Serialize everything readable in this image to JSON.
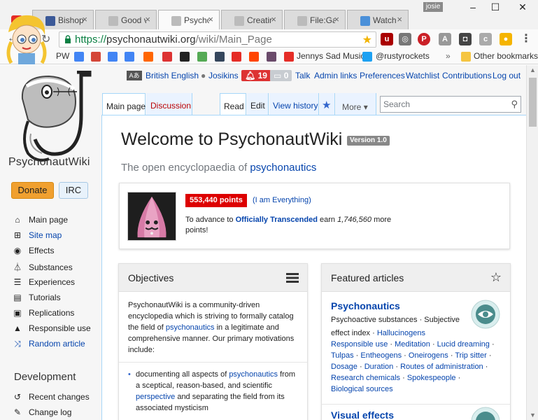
{
  "browser": {
    "tabs": [
      {
        "label": "Bishop N",
        "favicon_color": "#3b5998"
      },
      {
        "label": "Good vib",
        "favicon_color": "#888888"
      },
      {
        "label": "Psychona",
        "favicon_color": "#888888"
      },
      {
        "label": "Creating",
        "favicon_color": "#888888"
      },
      {
        "label": "File:Galle",
        "favicon_color": "#888888"
      },
      {
        "label": "Watch O",
        "favicon_color": "#4a90d9"
      }
    ],
    "profile_name": "josie",
    "url_scheme": "https://",
    "url_host": "psychonautwiki.org",
    "url_path": "/wiki/Main_Page",
    "bookmarks": [
      "PW",
      "Jennys Sad Music",
      "@rustyrockets",
      "Other bookmarks"
    ],
    "bookmark_more": "»",
    "colors": {
      "tab_bar": "#f2f2f2",
      "youtube": "#e52d27",
      "secure": "#0b8043"
    }
  },
  "header": {
    "language": "British English",
    "username": "Josikins",
    "notifications": "19",
    "messages": "0",
    "links": [
      "Talk",
      "Admin links",
      "Preferences",
      "Watchlist",
      "Contributions",
      "Log out"
    ]
  },
  "sidebar": {
    "logo_text": "PsychonautWiki",
    "donate": "Donate",
    "irc": "IRC",
    "items": [
      {
        "label": "Main page",
        "icon": "home-icon"
      },
      {
        "label": "Site map",
        "icon": "sitemap-icon"
      },
      {
        "label": "Effects",
        "icon": "eye-icon"
      },
      {
        "label": "Substances",
        "icon": "flask-icon"
      },
      {
        "label": "Experiences",
        "icon": "list-icon"
      },
      {
        "label": "Tutorials",
        "icon": "book-icon"
      },
      {
        "label": "Replications",
        "icon": "image-icon"
      },
      {
        "label": "Responsible use",
        "icon": "warning-icon"
      },
      {
        "label": "Random article",
        "icon": "random-icon"
      }
    ],
    "dev_heading": "Development",
    "dev_items": [
      {
        "label": "Recent changes",
        "icon": "history-icon"
      },
      {
        "label": "Change log",
        "icon": "changelog-icon"
      }
    ]
  },
  "content_tabs": {
    "left": [
      "Main page",
      "Discussion"
    ],
    "right": [
      "Read",
      "Edit",
      "View history"
    ],
    "more": "More",
    "search_placeholder": "Search"
  },
  "main": {
    "title": "Welcome to PsychonautWiki",
    "version": "Version 1.0",
    "subtitle_prefix": "The open encyclopaedia of ",
    "subtitle_link": "psychonautics",
    "user_points": "553,440 points",
    "user_rank": "(I am Everything)",
    "advance_prefix": "To advance to ",
    "advance_level": "Officially Transcended",
    "advance_mid": " earn ",
    "advance_points": "1,746,560",
    "advance_suffix": " more points!"
  },
  "objectives": {
    "title": "Objectives",
    "intro_1": "PsychonautWiki is a community-driven encyclopedia which is striving to formally catalog the field of ",
    "intro_link": "psychonautics",
    "intro_2": " in a legitimate and comprehensive manner. Our primary motivations include:",
    "bullet_1": "documenting all aspects of ",
    "bullet_link": "psychonautics",
    "bullet_2": " from a sceptical, reason-based, and scientific ",
    "bullet_link_2": "perspective",
    "bullet_3": " and separating the field from its associated mysticism"
  },
  "featured": {
    "title": "Featured articles",
    "article_title": "Psychonautics",
    "article_line1": "Psychoactive substances · Subjective",
    "article_line2": "effect index · ",
    "links": [
      "Hallucinogens",
      "Responsible use",
      "Meditation",
      "Lucid dreaming",
      "Tulpas",
      "Entheogens",
      "Oneirogens",
      "Trip sitter",
      "Dosage",
      "Duration",
      "Routes of administration",
      "Research chemicals",
      "Spokespeople",
      "Biological sources"
    ],
    "article2_title": "Visual effects"
  }
}
